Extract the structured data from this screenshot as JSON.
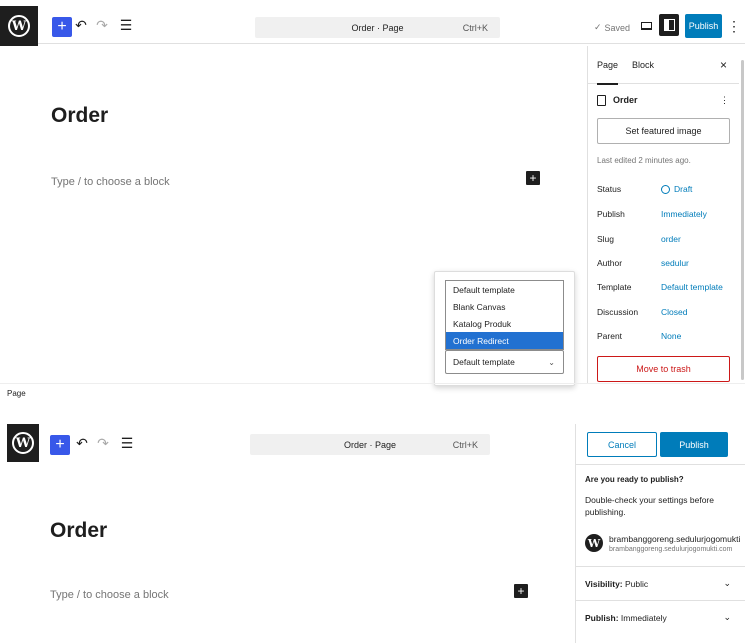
{
  "top": {
    "document_title": "Order · Page",
    "shortcut": "Ctrl+K",
    "saved_label": "Saved",
    "publish_label": "Publish",
    "more_icon": "⋮",
    "heading": "Order",
    "placeholder": "Type / to choose a block",
    "sidebar": {
      "tab_page": "Page",
      "tab_block": "Block",
      "close": "×",
      "page_icon": "page-icon",
      "page_name": "Order",
      "featured_image": "Set featured image",
      "last_edited": "Last edited 2 minutes ago.",
      "rows": [
        {
          "label": "Status",
          "value": "Draft"
        },
        {
          "label": "Publish",
          "value": "Immediately"
        },
        {
          "label": "Slug",
          "value": "order"
        },
        {
          "label": "Author",
          "value": "sedulur"
        },
        {
          "label": "Template",
          "value": "Default template"
        },
        {
          "label": "Discussion",
          "value": "Closed"
        },
        {
          "label": "Parent",
          "value": "None"
        }
      ],
      "trash": "Move to trash"
    },
    "template_options": [
      "Default template",
      "Blank Canvas",
      "Katalog Produk",
      "Order Redirect"
    ],
    "template_selected_option": "Order Redirect",
    "template_select_value": "Default template"
  },
  "mode_label": "Page",
  "bottom": {
    "document_title": "Order · Page",
    "shortcut": "Ctrl+K",
    "heading": "Order",
    "placeholder": "Type / to choose a block",
    "cancel_label": "Cancel",
    "publish_label": "Publish",
    "ready": "Are you ready to publish?",
    "double_check": "Double-check your settings before publishing.",
    "site_name": "brambanggoreng.sedulurjogomukti",
    "site_url": "brambanggoreng.sedulurjogomukti.com",
    "visibility_label": "Visibility:",
    "visibility_value": "Public",
    "publish_label_row": "Publish:",
    "publish_value": "Immediately"
  },
  "colors": {
    "accent": "#007cba",
    "admin_blue": "#3858e9",
    "danger": "#cc1818",
    "dark": "#1e1e1e"
  }
}
